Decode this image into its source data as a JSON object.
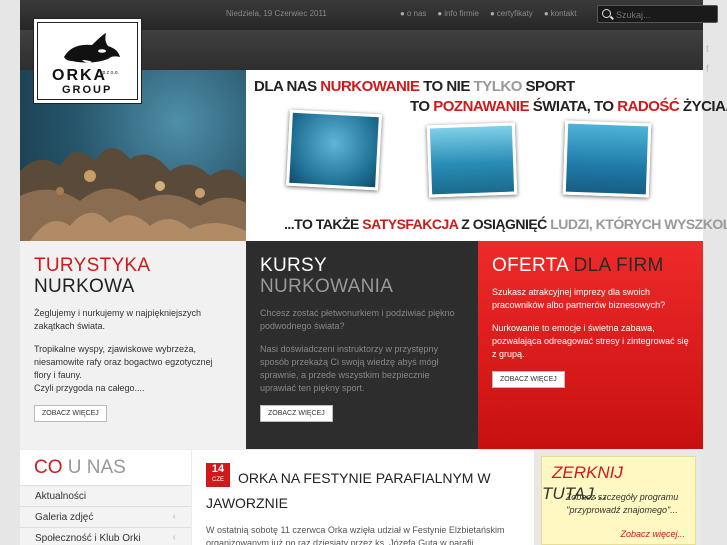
{
  "header": {
    "date": "Niedziela, 19 Czerwiec 2011",
    "nav": [
      "o nas",
      "info firmie",
      "certyfikaty",
      "kontakt"
    ],
    "search_placeholder": "Szukaj...",
    "social": [
      "t",
      "f"
    ]
  },
  "logo": {
    "name": "ORKA",
    "sub": "GROUP",
    "suffix": "sp.z o.o."
  },
  "hero": {
    "line1": [
      {
        "t": "DLA NAS ",
        "c": "dark"
      },
      {
        "t": "NURKOWANIE",
        "c": "red"
      },
      {
        "t": " TO NIE ",
        "c": "dark"
      },
      {
        "t": "TYLKO ",
        "c": "grey"
      },
      {
        "t": "SPORT",
        "c": "dark"
      }
    ],
    "line2": [
      {
        "t": "TO ",
        "c": "dark"
      },
      {
        "t": "POZNAWANIE",
        "c": "red"
      },
      {
        "t": " ŚWIATA, TO ",
        "c": "dark"
      },
      {
        "t": "RADOŚĆ",
        "c": "red"
      },
      {
        "t": " ŻYCIA...",
        "c": "dark"
      }
    ],
    "line3": [
      {
        "t": "...TO TAKŻE ",
        "c": "dark"
      },
      {
        "t": "SATYSFAKCJA",
        "c": "red"
      },
      {
        "t": " Z OSIĄGNIĘĆ ",
        "c": "dark"
      },
      {
        "t": "LUDZI, KTÓRYCH WYSZKOLILIŚMY.",
        "c": "grey"
      }
    ]
  },
  "boxes": [
    {
      "title1": "TURYSTYKA",
      "title2": "NURKOWA",
      "p1": "Żeglujemy i nurkujemy w najpiękniejszych zakątkach świata.",
      "p2": "Tropikalne wyspy, zjawiskowe wybrzeża, niesamowite rafy oraz bogactwo egzotycznej flory i fauny.",
      "p3": "Czyli przygoda na całego....",
      "button": "ZOBACZ WIĘCEJ"
    },
    {
      "title1": "KURSY",
      "title2": "NURKOWANIA",
      "p1": "Chcesz zostać płetwonurkiem i podziwiać piękno podwodnego świata?",
      "p2": "Nasi doświadczeni instruktorzy w przystępny sposób przekażą Ci swoją wiedzę abyś mógł sprawnie, a przede wszystkim bezpiecznie uprawiać ten piękny sport.",
      "button": "ZOBACZ WIĘCEJ"
    },
    {
      "title1": "OFERTA",
      "title2": "DLA FIRM",
      "p1": "Szukasz atrakcyjnej imprezy dla swoich pracowników albo partnerów biznesowych?",
      "p2": "Nurkowanie to emocje i świetna zabawa, pozwalająca odreagować stresy i zintegrować się z grupą.",
      "button": "ZOBACZ WIĘCEJ"
    }
  ],
  "about": {
    "title1": "CO",
    "title2": "U NAS",
    "menu": [
      "Aktualności",
      "Galeria zdjęć",
      "Społeczność i Klub Orki"
    ]
  },
  "news": {
    "day": "14",
    "month": "CZE",
    "title": "ORKA NA FESTYNIE PARAFIALNYM W JAWORZNIE",
    "body": "W ostatnią sobotę 11 czerwca Orka wzięła udział w Festynie Elżbietańskim organizowanym już po raz dziesiąty przez ks. Józefa Guta w parafii"
  },
  "promo": {
    "title1": "ZERKNIJ",
    "title2": "TUTAJ...",
    "text": "Zobacz szczegóły programu \"przyprowadź znajomego\"...",
    "more": "Zobacz więcej..."
  },
  "colors": {
    "accent": "#d0191b",
    "dark": "#2d2d2d",
    "bar": "#333333"
  }
}
